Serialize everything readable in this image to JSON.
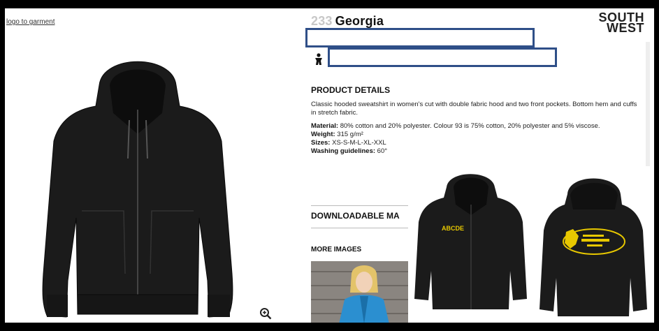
{
  "header": {
    "logo_link": "logo to garment",
    "product_number": "233",
    "product_name": "Georgia",
    "brand_line1": "SOUTH",
    "brand_line2": "WEST"
  },
  "details": {
    "heading": "PRODUCT DETAILS",
    "description": "Classic hooded sweatshirt in women's cut with double fabric hood and two front pockets. Bottom hem and cuffs in stretch fabric.",
    "material_label": "Material:",
    "material_value": "80% cotton and 20% polyester. Colour 93 is 75% cotton, 20% polyester and 5% viscose.",
    "weight_label": "Weight:",
    "weight_value": "315 g/m²",
    "sizes_label": "Sizes:",
    "sizes_value": "XS-S-M-L-XL-XXL",
    "washing_label": "Washing guidelines:",
    "washing_value": "60°"
  },
  "downloadable_heading": "DOWNLOADABLE MA",
  "more_images_heading": "MORE IMAGES",
  "inset": {
    "front_chest_text": "ABCDE"
  },
  "colors": {
    "redaction_border": "#2f4f88",
    "garment": "#1b1b1b",
    "print_yellow": "#e8c800"
  },
  "icons": [
    "zoom-in-icon",
    "person-icon"
  ]
}
